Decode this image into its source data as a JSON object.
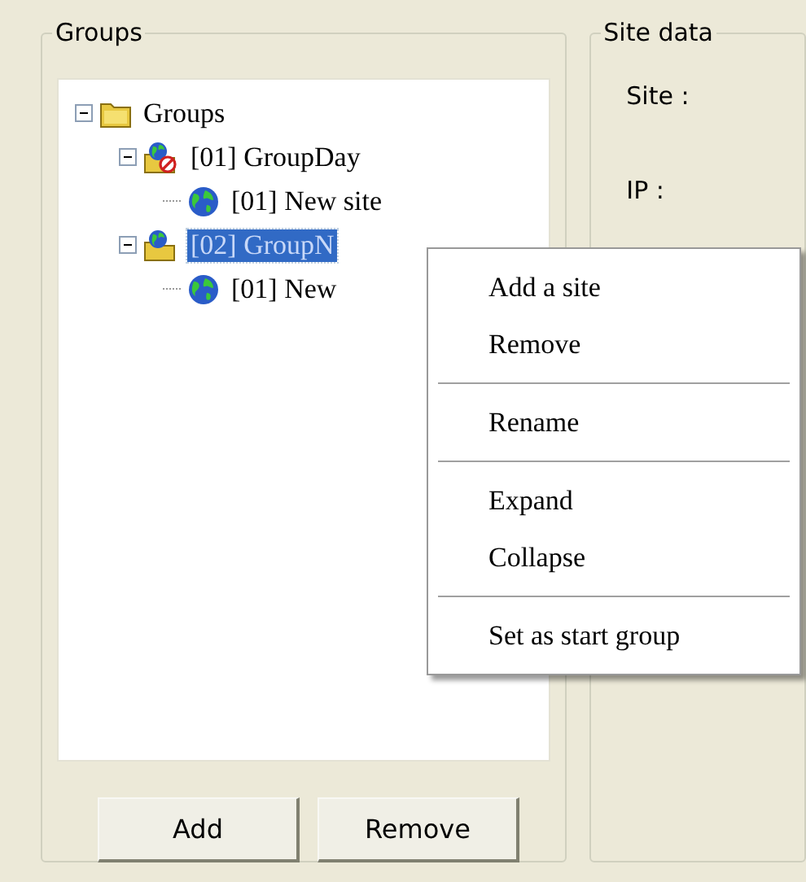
{
  "groups_panel": {
    "title": "Groups",
    "tree": [
      {
        "label": "Groups",
        "kind": "folder",
        "expanded": true,
        "selected": false,
        "children": [
          {
            "label": "[01] GroupDay",
            "kind": "group",
            "blocked": true,
            "expanded": true,
            "selected": false,
            "children": [
              {
                "label": "[01] New site",
                "kind": "site",
                "selected": false
              }
            ]
          },
          {
            "label": "[02] GroupN",
            "kind": "group",
            "blocked": false,
            "expanded": true,
            "selected": true,
            "children": [
              {
                "label": "[01] New",
                "kind": "site",
                "selected": false
              }
            ]
          }
        ]
      }
    ],
    "buttons": [
      "Add",
      "Remove"
    ]
  },
  "site_panel": {
    "title": "Site data",
    "fields": [
      "Site :",
      "IP :"
    ]
  },
  "context_menu": {
    "sections": [
      [
        "Add a site",
        "Remove"
      ],
      [
        "Rename"
      ],
      [
        "Expand",
        "Collapse"
      ],
      [
        "Set as start group"
      ]
    ]
  }
}
